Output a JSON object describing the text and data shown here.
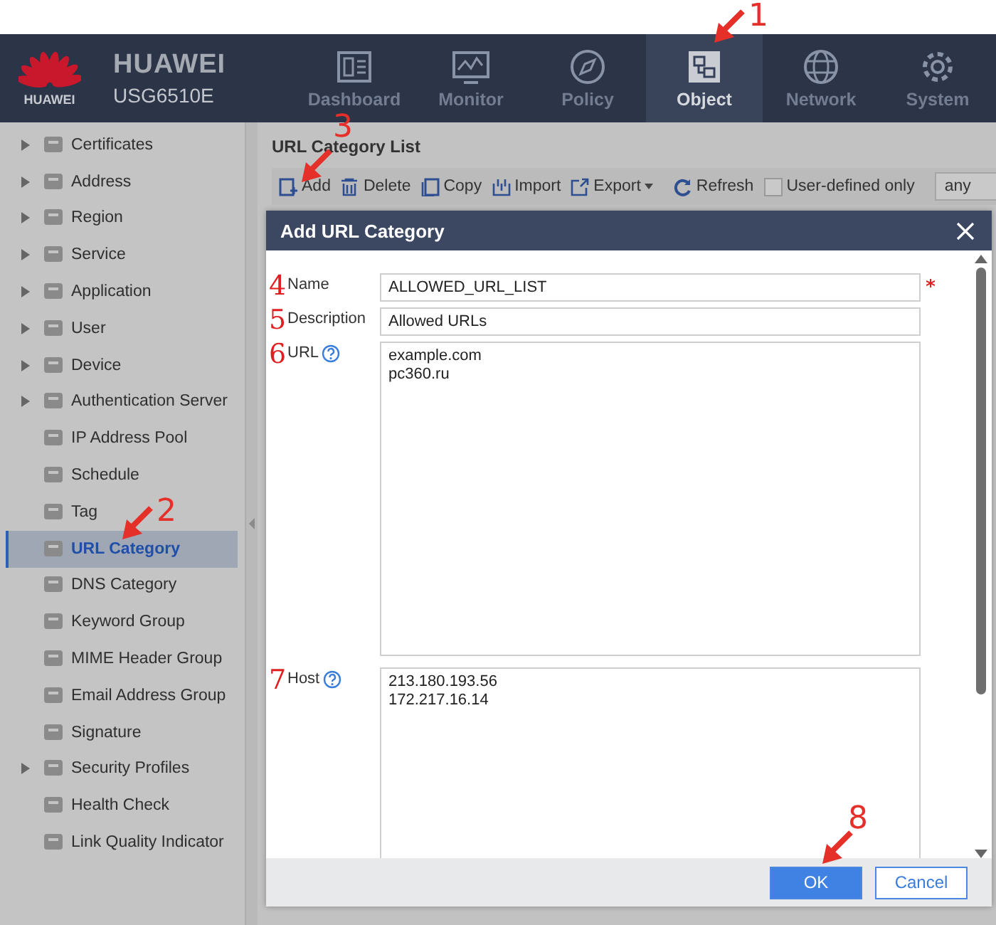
{
  "header": {
    "brand": "HUAWEI",
    "logo_caption": "HUAWEI",
    "model": "USG6510E",
    "nav": [
      {
        "label": "Dashboard",
        "selected": false
      },
      {
        "label": "Monitor",
        "selected": false
      },
      {
        "label": "Policy",
        "selected": false
      },
      {
        "label": "Object",
        "selected": true
      },
      {
        "label": "Network",
        "selected": false
      },
      {
        "label": "System",
        "selected": false
      }
    ]
  },
  "sidebar": {
    "items": [
      {
        "label": "Certificates",
        "expandable": true,
        "selected": false
      },
      {
        "label": "Address",
        "expandable": true,
        "selected": false
      },
      {
        "label": "Region",
        "expandable": true,
        "selected": false
      },
      {
        "label": "Service",
        "expandable": true,
        "selected": false
      },
      {
        "label": "Application",
        "expandable": true,
        "selected": false
      },
      {
        "label": "User",
        "expandable": true,
        "selected": false
      },
      {
        "label": "Device",
        "expandable": true,
        "selected": false
      },
      {
        "label": "Authentication Server",
        "expandable": true,
        "selected": false
      },
      {
        "label": "IP Address Pool",
        "expandable": false,
        "selected": false
      },
      {
        "label": "Schedule",
        "expandable": false,
        "selected": false
      },
      {
        "label": "Tag",
        "expandable": false,
        "selected": false
      },
      {
        "label": "URL Category",
        "expandable": false,
        "selected": true
      },
      {
        "label": "DNS Category",
        "expandable": false,
        "selected": false
      },
      {
        "label": "Keyword Group",
        "expandable": false,
        "selected": false
      },
      {
        "label": "MIME Header Group",
        "expandable": false,
        "selected": false
      },
      {
        "label": "Email Address Group",
        "expandable": false,
        "selected": false
      },
      {
        "label": "Signature",
        "expandable": false,
        "selected": false
      },
      {
        "label": "Security Profiles",
        "expandable": true,
        "selected": false
      },
      {
        "label": "Health Check",
        "expandable": false,
        "selected": false
      },
      {
        "label": "Link Quality Indicator",
        "expandable": false,
        "selected": false
      }
    ]
  },
  "list": {
    "title": "URL Category List",
    "toolbar": [
      {
        "label": "Add",
        "dropdown": false
      },
      {
        "label": "Delete",
        "dropdown": false
      },
      {
        "label": "Copy",
        "dropdown": false
      },
      {
        "label": "Import",
        "dropdown": false
      },
      {
        "label": "Export",
        "dropdown": true
      }
    ],
    "refresh": "Refresh",
    "filter": {
      "label": "User-defined only",
      "checked": false
    },
    "select": "any"
  },
  "dialog": {
    "title": "Add URL Category",
    "fields": [
      {
        "kind": "input",
        "marker": "4",
        "label": "Name",
        "value": "ALLOWED_URL_LIST",
        "required": true,
        "help": false
      },
      {
        "kind": "input",
        "marker": "5",
        "label": "Description",
        "value": "Allowed URLs",
        "required": false,
        "help": false
      },
      {
        "kind": "textarea",
        "marker": "6",
        "label": "URL",
        "value": "example.com\npc360.ru",
        "required": false,
        "help": true
      },
      {
        "kind": "textarea",
        "marker": "7",
        "label": "Host",
        "value": "213.180.193.56\n172.217.16.14",
        "required": false,
        "help": true
      }
    ],
    "buttons": [
      {
        "label": "OK",
        "primary": true
      },
      {
        "label": "Cancel",
        "primary": false
      }
    ]
  },
  "annotations": [
    {
      "number": "1"
    },
    {
      "number": "2"
    },
    {
      "number": "3"
    },
    {
      "number": "8"
    }
  ]
}
